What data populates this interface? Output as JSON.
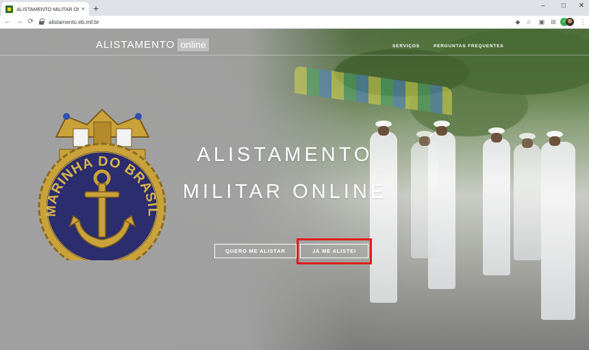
{
  "browser": {
    "tab_title": "ALISTAMENTO MILITAR ONLINE",
    "tab_close": "×",
    "new_tab": "+",
    "window_controls": {
      "minimize": "–",
      "maximize": "□",
      "close": "✕"
    },
    "url": "alistamento.eb.mil.br",
    "nav": {
      "back": "←",
      "forward": "→",
      "reload": "⟳"
    }
  },
  "navbar": {
    "brand_main": "ALISTAMENTO",
    "brand_sub": "online",
    "menu": [
      {
        "label": "SERVIÇOS"
      },
      {
        "label": "PERGUNTAS FREQUENTES"
      }
    ]
  },
  "emblem": {
    "ring_text": "MARINHA DO BRASIL",
    "icon": "navy-anchor-emblem"
  },
  "hero": {
    "title_line1": "ALISTAMENTO",
    "title_line2": "MILITAR ONLINE",
    "buttons": [
      {
        "label": "QUERO ME ALISTAR"
      },
      {
        "label": "JÁ ME ALISTEI"
      }
    ]
  },
  "colors": {
    "highlight_box": "#e01b1b",
    "emblem_navy": "#2b2d6e",
    "emblem_gold": "#c9a23a"
  }
}
